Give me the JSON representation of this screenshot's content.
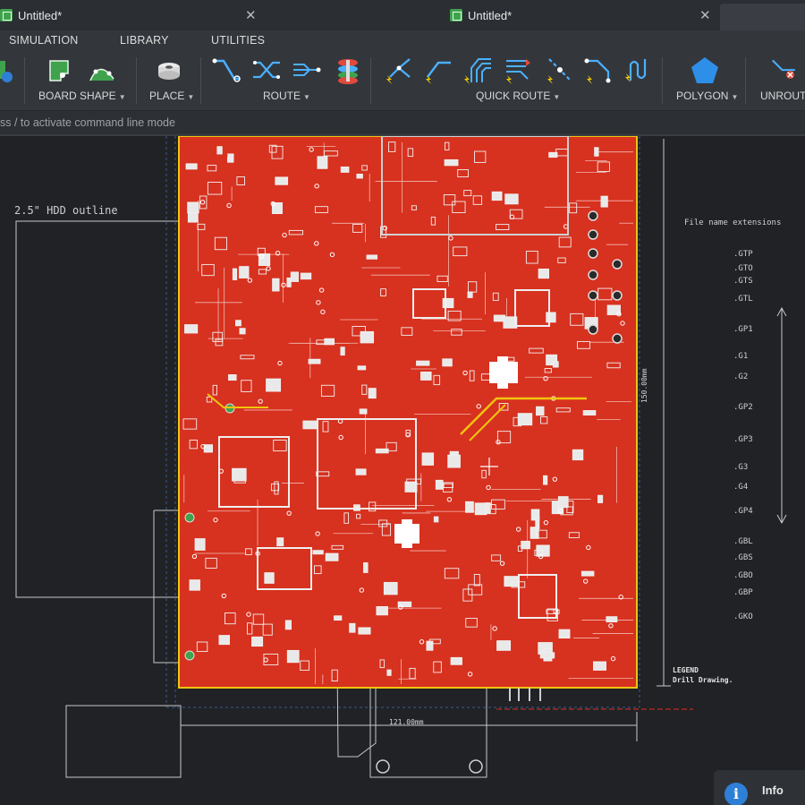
{
  "tabs": [
    {
      "title": "Untitled*"
    },
    {
      "title": "Untitled*"
    }
  ],
  "menu": [
    "SIMULATION",
    "LIBRARY",
    "UTILITIES"
  ],
  "ribbon": {
    "groups": [
      {
        "label": "BOARD SHAPE"
      },
      {
        "label": "PLACE"
      },
      {
        "label": "ROUTE"
      },
      {
        "label": "QUICK ROUTE"
      },
      {
        "label": "POLYGON"
      },
      {
        "label": "UNROUT"
      }
    ]
  },
  "command_line": {
    "text": "ss / to activate command line mode"
  },
  "drawing": {
    "hdd_outline_label": "2.5\" HDD outline",
    "file_ext_title": "File name extensions",
    "width_dim": "121.00mm",
    "height_dim": "150.00mm",
    "legend_lines": [
      "LEGEND",
      "Drill Drawing."
    ],
    "extensions": [
      ".GTP",
      ".GTO",
      ".GTS",
      ".GTL",
      ".GP1",
      ".G1",
      ".G2",
      ".GP2",
      ".GP3",
      ".G3",
      ".G4",
      ".GP4",
      ".GBL",
      ".GBS",
      ".GBO",
      ".GBP",
      ".GKO"
    ]
  },
  "info": {
    "label": "Info"
  },
  "colors": {
    "board": "#d7311f",
    "board_outline": "#f1c40f",
    "trace": "#e8e8e8",
    "background": "#202226",
    "accent": "#2e7fd6"
  }
}
